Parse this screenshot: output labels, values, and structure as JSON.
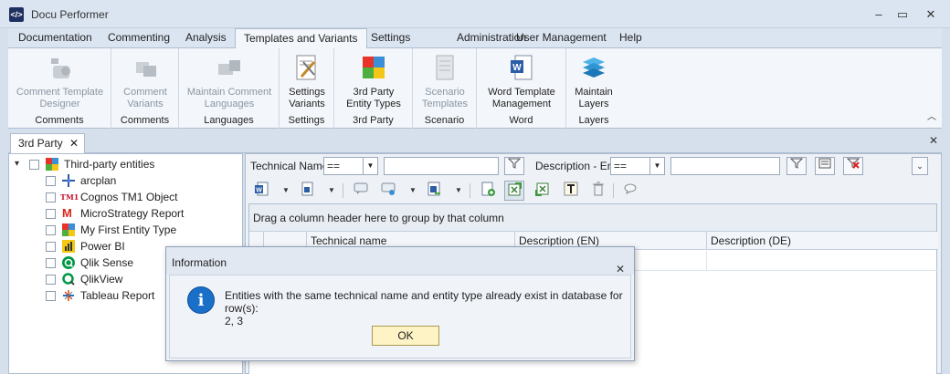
{
  "app": {
    "title": "Docu Performer",
    "logo": "</>"
  },
  "window_controls": {
    "minimize": "–",
    "restore": "▭",
    "close": "✕"
  },
  "menu": {
    "tabs": [
      "Documentation",
      "Commenting",
      "Analysis",
      "Templates and Variants",
      "Settings",
      "Administration",
      "User Management",
      "Help"
    ],
    "active": "Templates and Variants"
  },
  "ribbon": {
    "groups": [
      {
        "label": "Comments",
        "buttons": [
          {
            "label": "Comment Template\nDesigner",
            "icon": "comment-template-designer-icon",
            "enabled": false
          }
        ]
      },
      {
        "label": "Comments",
        "buttons": [
          {
            "label": "Comment\nVariants",
            "icon": "comment-variants-icon",
            "enabled": false
          }
        ]
      },
      {
        "label": "Languages",
        "buttons": [
          {
            "label": "Maintain Comment\nLanguages",
            "icon": "maintain-languages-icon",
            "enabled": false
          }
        ]
      },
      {
        "label": "Settings",
        "buttons": [
          {
            "label": "Settings\nVariants",
            "icon": "settings-variants-icon",
            "enabled": true
          }
        ]
      },
      {
        "label": "3rd Party",
        "buttons": [
          {
            "label": "3rd Party\nEntity Types",
            "icon": "entity-types-icon",
            "enabled": true
          }
        ]
      },
      {
        "label": "Scenario",
        "buttons": [
          {
            "label": "Scenario\nTemplates",
            "icon": "scenario-templates-icon",
            "enabled": false
          }
        ]
      },
      {
        "label": "Word",
        "buttons": [
          {
            "label": "Word Template\nManagement",
            "icon": "word-template-icon",
            "enabled": true
          }
        ]
      },
      {
        "label": "Layers",
        "buttons": [
          {
            "label": "Maintain\nLayers",
            "icon": "layers-icon",
            "enabled": true
          }
        ]
      }
    ]
  },
  "document_tab": {
    "label": "3rd Party",
    "close": "✕"
  },
  "tree": {
    "root": "Third-party entities",
    "items": [
      {
        "label": "arcplan",
        "icon": "arcplan-icon"
      },
      {
        "label": "Cognos TM1 Object",
        "icon": "cognos-tm1-icon",
        "icon_text": "TM1"
      },
      {
        "label": "MicroStrategy Report",
        "icon": "microstrategy-icon",
        "icon_text": "M"
      },
      {
        "label": "My First Entity Type",
        "icon": "puzzle-icon"
      },
      {
        "label": "Power BI",
        "icon": "power-bi-icon"
      },
      {
        "label": "Qlik Sense",
        "icon": "qlik-sense-icon"
      },
      {
        "label": "QlikView",
        "icon": "qlikview-icon"
      },
      {
        "label": "Tableau Report",
        "icon": "tableau-icon"
      }
    ]
  },
  "filters": {
    "technical_name_label": "Technical Name",
    "technical_name_operator": "==",
    "description_label": "Description - En",
    "description_operator": "=="
  },
  "grid": {
    "group_hint": "Drag a column header here to group by that column",
    "columns": [
      "Technical name",
      "Description (EN)",
      "Description (DE)"
    ]
  },
  "dialog": {
    "title": "Information",
    "close": "✕",
    "message_line1": "Entities with the same technical name and entity type already exist in database for row(s):",
    "message_line2": "2, 3",
    "ok_label": "OK",
    "icon_text": "i"
  },
  "colors": {
    "accent_blue": "#1a6fc9",
    "ribbon_bg": "#f3f6fa",
    "chrome_bg": "#dbe5f1",
    "ok_button": "#fdf3c4"
  }
}
